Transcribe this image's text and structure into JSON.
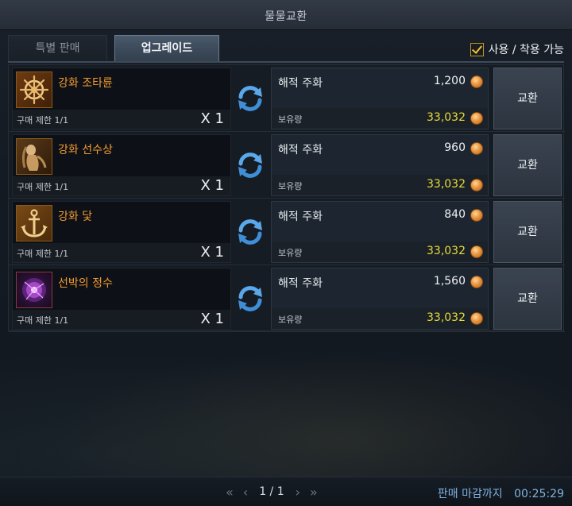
{
  "window": {
    "title": "물물교환"
  },
  "tabs": [
    {
      "label": "특별 판매"
    },
    {
      "label": "업그레이드"
    }
  ],
  "filter": {
    "label": "사용 / 착용 가능",
    "checked": true
  },
  "rows": [
    {
      "item_name": "강화 조타륜",
      "limit": "구매 제한 1/1",
      "qty": "X 1",
      "currency": "해적 주화",
      "cost": "1,200",
      "owned_label": "보유량",
      "owned": "33,032",
      "button": "교환",
      "icon": "helm-wheel-icon"
    },
    {
      "item_name": "강화 선수상",
      "limit": "구매 제한 1/1",
      "qty": "X 1",
      "currency": "해적 주화",
      "cost": "960",
      "owned_label": "보유량",
      "owned": "33,032",
      "button": "교환",
      "icon": "figurehead-icon"
    },
    {
      "item_name": "강화 닻",
      "limit": "구매 제한 1/1",
      "qty": "X 1",
      "currency": "해적 주화",
      "cost": "840",
      "owned_label": "보유량",
      "owned": "33,032",
      "button": "교환",
      "icon": "anchor-icon"
    },
    {
      "item_name": "선박의 정수",
      "limit": "구매 제한 1/1",
      "qty": "X 1",
      "currency": "해적 주화",
      "cost": "1,560",
      "owned_label": "보유량",
      "owned": "33,032",
      "button": "교환",
      "icon": "ship-essence-icon"
    }
  ],
  "pager": {
    "text": "1 / 1",
    "first": "«",
    "prev": "‹",
    "next": "›",
    "last": "»"
  },
  "deadline": {
    "label": "판매 마감까지",
    "time": "00:25:29"
  },
  "colors": {
    "item_name": "#f29a2e",
    "owned": "#e8dc3a",
    "deadline": "#7fb2e0",
    "accent_tab": "#3a4858"
  }
}
